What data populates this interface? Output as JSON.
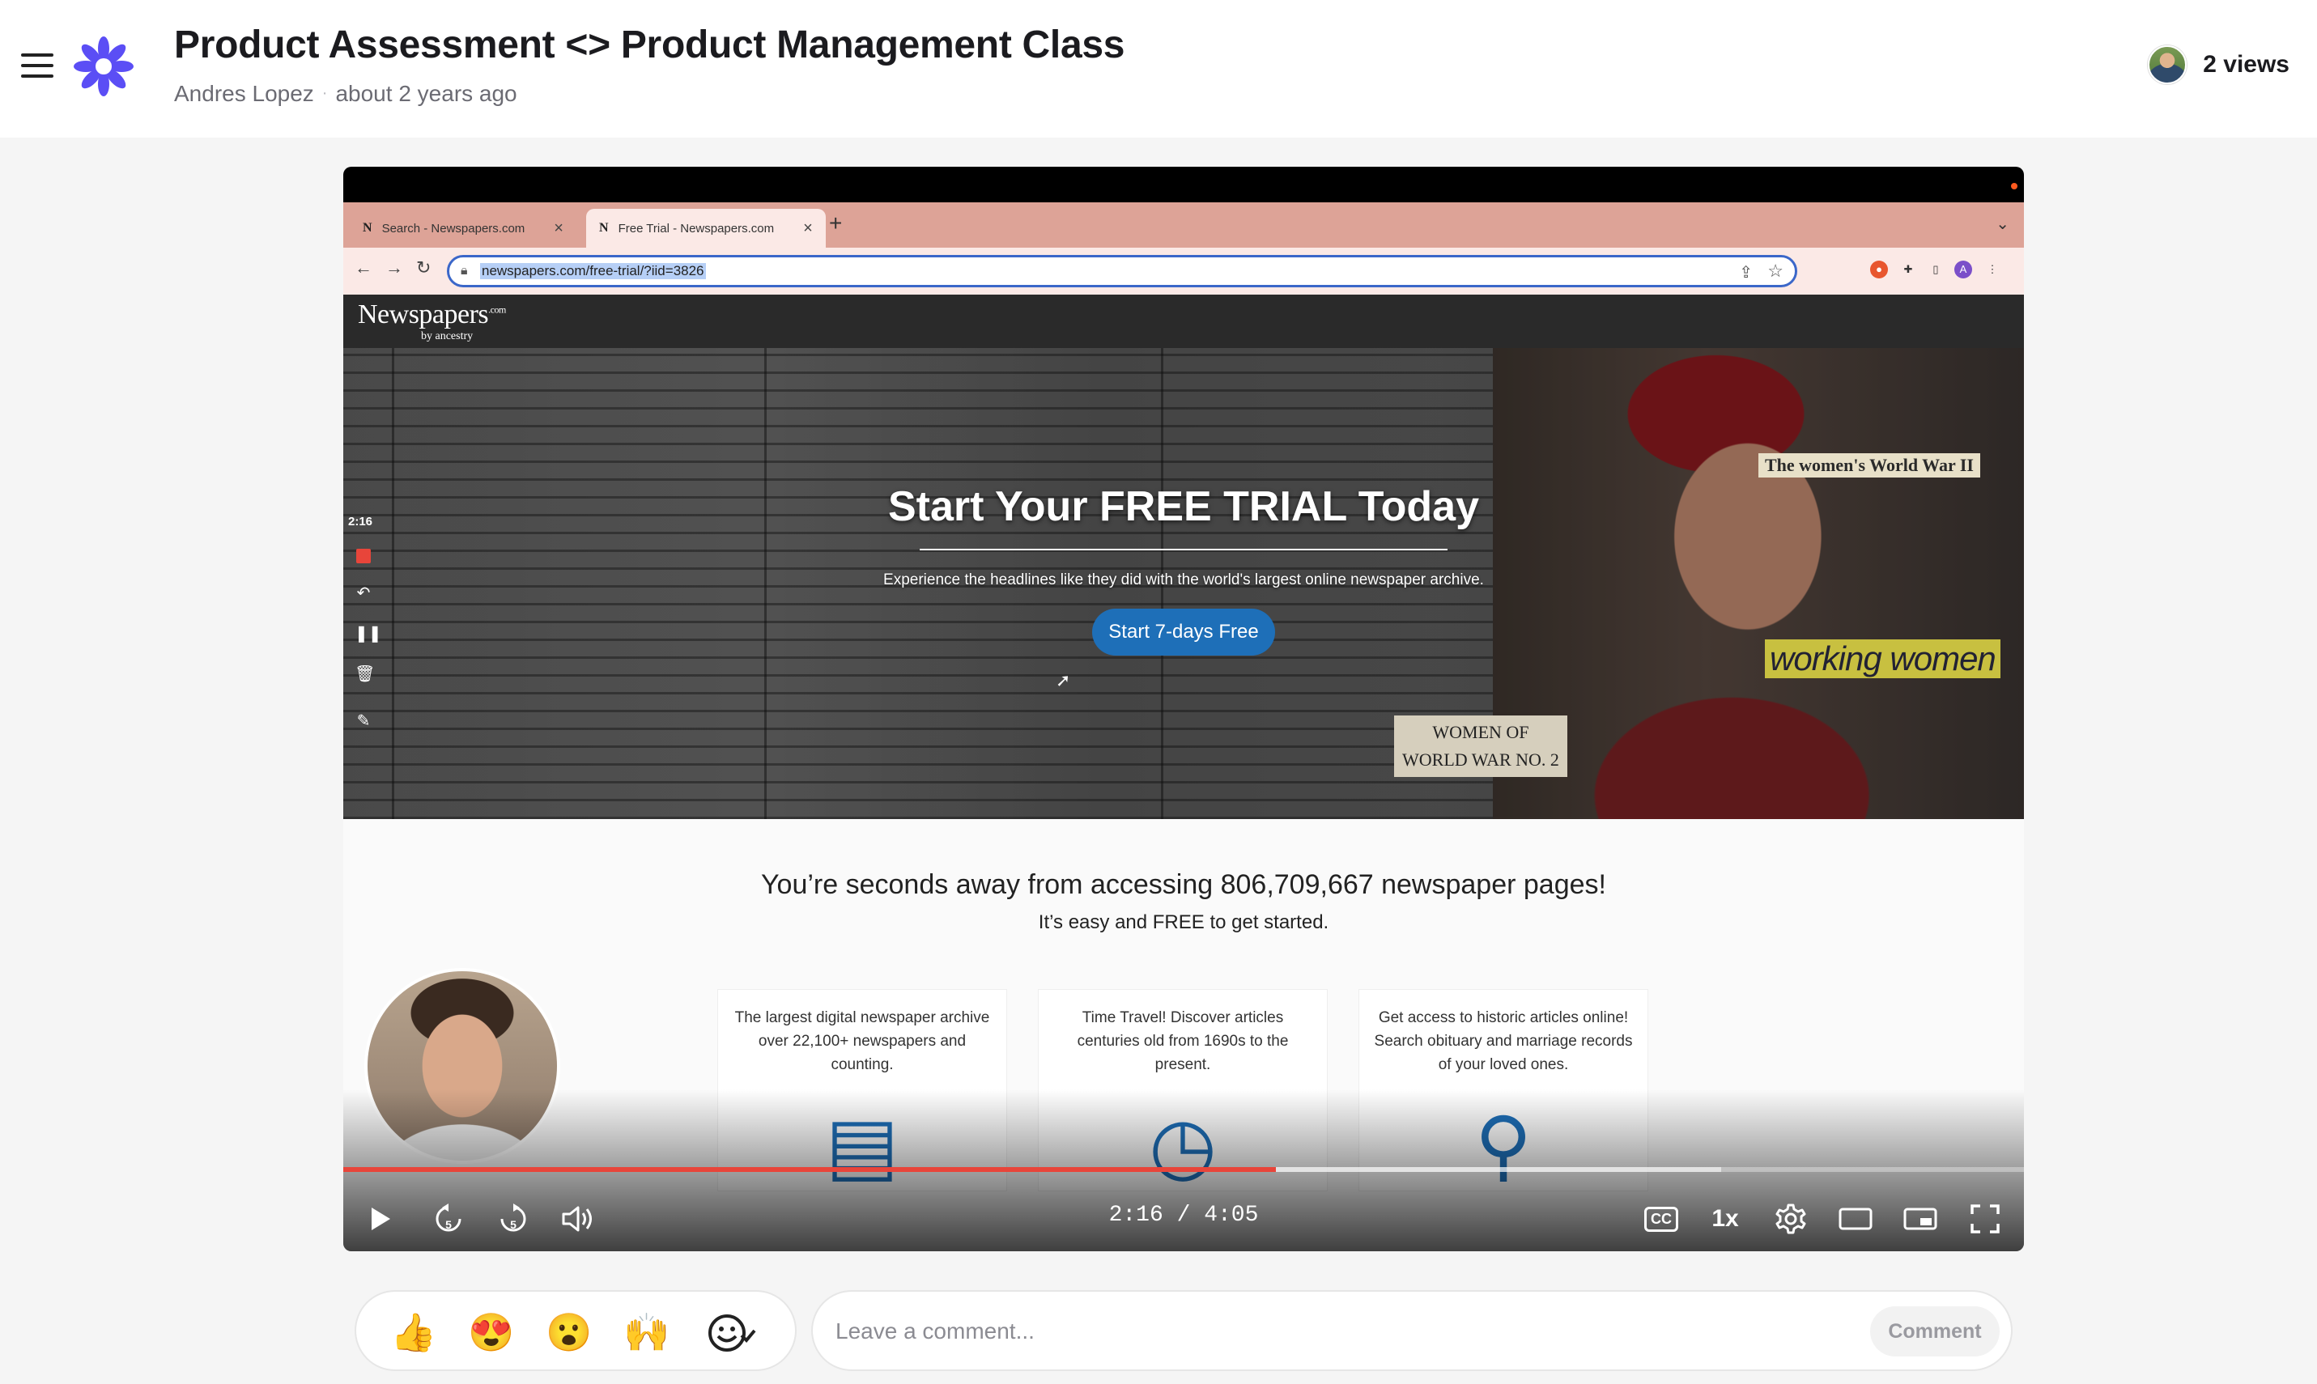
{
  "header": {
    "title": "Product Assessment <> Product Management Class",
    "author": "Andres Lopez",
    "separator": "·",
    "time_ago": "about 2 years ago",
    "views": "2 views",
    "logo_color": "#5b4ef5"
  },
  "browser": {
    "tabs": [
      {
        "favicon": "N",
        "label": "Search - Newspapers.com",
        "close": "×",
        "active": false
      },
      {
        "favicon": "N",
        "label": "Free Trial - Newspapers.com",
        "close": "×",
        "active": true
      }
    ],
    "new_tab": "+",
    "url": "newspapers.com/free-trial/?iid=3826",
    "profile_initial": "A"
  },
  "site": {
    "logo": "Newspapers",
    "logo_sub": ".com",
    "by_line": "by ancestry",
    "hero_title": "Start Your FREE TRIAL Today",
    "hero_sub": "Experience the headlines like they did with the world's largest online newspaper archive.",
    "cta": "Start 7-days Free",
    "tag_ww2": "The women's World War II",
    "tag_working": "working women",
    "tag_women_line1": "WOMEN OF",
    "tag_women_line2": "WORLD WAR NO. 2",
    "content_title": "You’re seconds away from accessing 806,709,667 newspaper pages!",
    "content_sub": "It’s easy and FREE to get started.",
    "features": [
      {
        "text": "The largest digital newspaper archive over 22,100+ newspapers and counting.",
        "icon": "pages-icon"
      },
      {
        "text": "Time Travel! Discover articles centuries old from 1690s to the present.",
        "icon": "clock-icon"
      },
      {
        "text": "Get access to historic articles online! Search obituary and marriage records of your loved ones.",
        "icon": "people-search-icon"
      }
    ]
  },
  "recorder": {
    "elapsed": "2:16"
  },
  "player": {
    "current_time": "2:16",
    "duration": "4:05",
    "time_display": "2:16 / 4:05",
    "progress_fraction": 0.555,
    "buffered_fraction": 0.82,
    "speed": "1x",
    "cc": "CC",
    "accent": "#e8453a"
  },
  "reactions": [
    "👍",
    "😍",
    "😮",
    "🙌"
  ],
  "comment": {
    "placeholder": "Leave a comment...",
    "button": "Comment"
  }
}
